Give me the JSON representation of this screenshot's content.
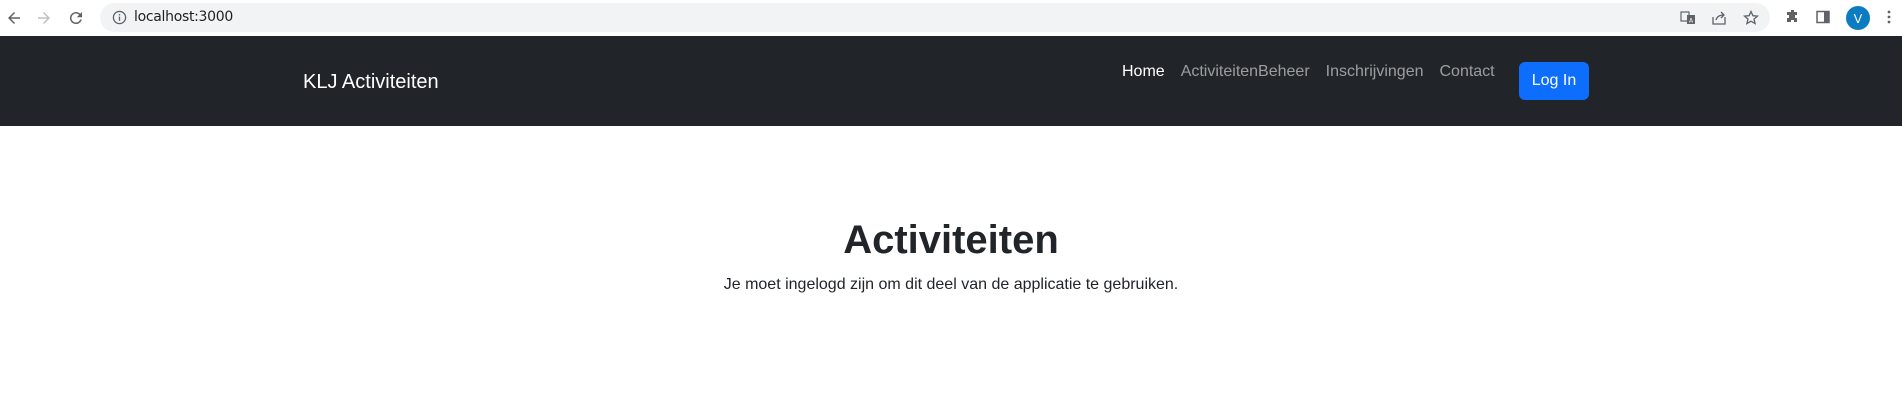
{
  "browser": {
    "url": "localhost:3000",
    "avatar_letter": "V",
    "icons": [
      "back-arrow-icon",
      "forward-arrow-icon",
      "reload-icon",
      "info-icon",
      "translate-icon",
      "share-icon",
      "star-icon",
      "extensions-icon",
      "side-panel-icon",
      "menu-dots-icon"
    ]
  },
  "navbar": {
    "brand": "KLJ Activiteiten",
    "links": [
      {
        "label": "Home",
        "active": true
      },
      {
        "label": "ActiviteitenBeheer",
        "active": false
      },
      {
        "label": "Inschrijvingen",
        "active": false
      },
      {
        "label": "Contact",
        "active": false
      }
    ],
    "login_label": "Log In",
    "background_color": "#212529",
    "button_color": "#0d6efd"
  },
  "main": {
    "title": "Activiteiten",
    "message": "Je moet ingelogd zijn om dit deel van de applicatie te gebruiken."
  }
}
